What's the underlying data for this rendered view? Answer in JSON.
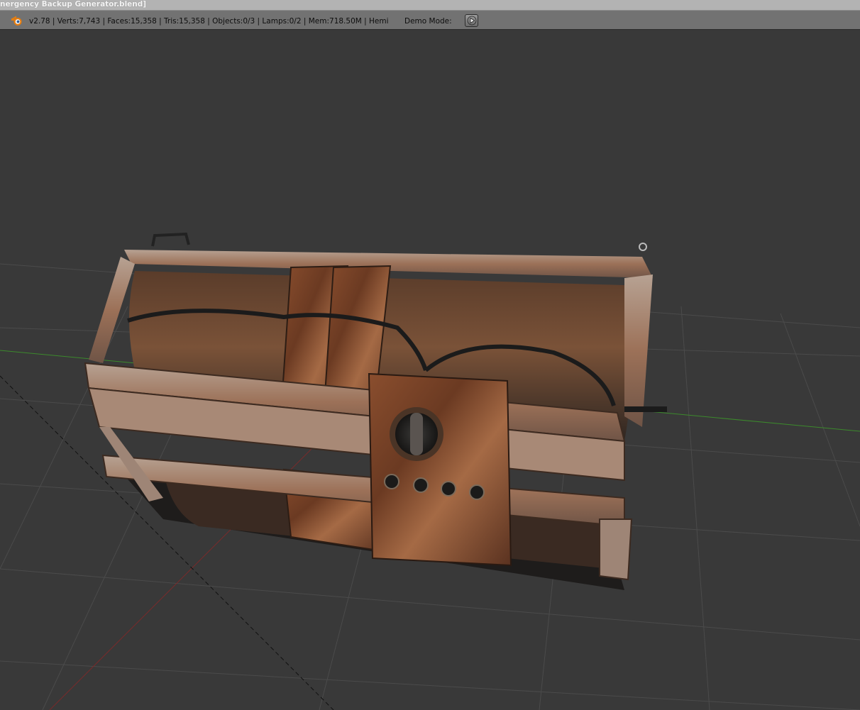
{
  "window": {
    "title": "nergency Backup Generator.blend]"
  },
  "infobar": {
    "logo_icon": "blender-logo-icon",
    "stats": "v2.78 | Verts:7,743 | Faces:15,358 | Tris:15,358 | Objects:0/3 | Lamps:0/2 | Mem:718.50M | Hemi",
    "demo_mode_label": "Demo Mode:",
    "play_icon": "play-icon"
  },
  "viewport": {
    "object": "emergency backup generator mesh",
    "x_axis_color": "#7a2a2a",
    "y_axis_color": "#3c8a2c",
    "grid_color": "#4a4a4a",
    "background": "#393939"
  }
}
